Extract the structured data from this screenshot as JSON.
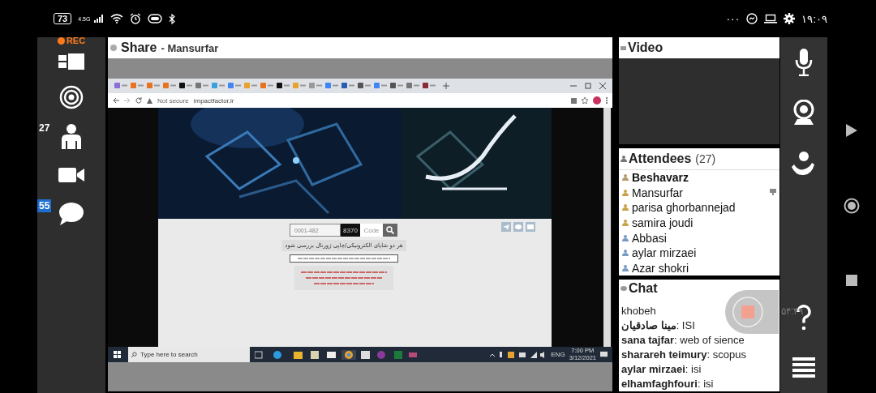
{
  "status_bar": {
    "battery": "73",
    "network": "4.5G",
    "more": "···",
    "time": "۱۹:۰۹"
  },
  "recording": {
    "label": "REC"
  },
  "left_rail": [
    {
      "kind": "layout"
    },
    {
      "kind": "broadcast"
    },
    {
      "kind": "attendees",
      "badge": "27"
    },
    {
      "kind": "camera"
    },
    {
      "kind": "chat",
      "badge": "55"
    }
  ],
  "share": {
    "title": "Share",
    "presenter": "- Mansurfar",
    "screen": {
      "address": {
        "warning": "Not secure",
        "url": "impactfactor.ir"
      },
      "form": {
        "issn": "0001-482",
        "captcha": "8370",
        "code_placeholder": "Code",
        "hint": "هر دو شاپای الکترونیکی/چاپی ژورنال بررسی شود"
      },
      "taskbar": {
        "search_placeholder": "Type here to search",
        "language": "ENG",
        "time": "7:00 PM",
        "date": "3/12/2021"
      }
    }
  },
  "video": {
    "title": "Video"
  },
  "attendees": {
    "title": "Attendees",
    "count": "(27)",
    "items": [
      {
        "name": "Beshavarz",
        "kind": "host"
      },
      {
        "name": "Mansurfar",
        "kind": "presenter"
      },
      {
        "name": "parisa ghorbannejad",
        "kind": "moderator"
      },
      {
        "name": "samira joudi",
        "kind": "moderator"
      },
      {
        "name": "Abbasi",
        "kind": "attendee"
      },
      {
        "name": "aylar mirzaei",
        "kind": "attendee"
      },
      {
        "name": "Azar shokri",
        "kind": "attendee"
      }
    ]
  },
  "chat": {
    "title": "Chat",
    "messages": [
      "khobeh",
      "**مینا صادقیان**: ISI",
      "**sana tajfar**: web of sience",
      "**sharareh teimury**: scopus",
      "**aylar mirzaei**: isi",
      "**elhamfaghfouri**: isi"
    ]
  },
  "recorder": {
    "timer": "۵۴:۴۹"
  },
  "right_rail": [
    {
      "kind": "microphone"
    },
    {
      "kind": "webcam"
    },
    {
      "kind": "raise-hand"
    },
    {
      "kind": "help"
    },
    {
      "kind": "menu"
    }
  ]
}
